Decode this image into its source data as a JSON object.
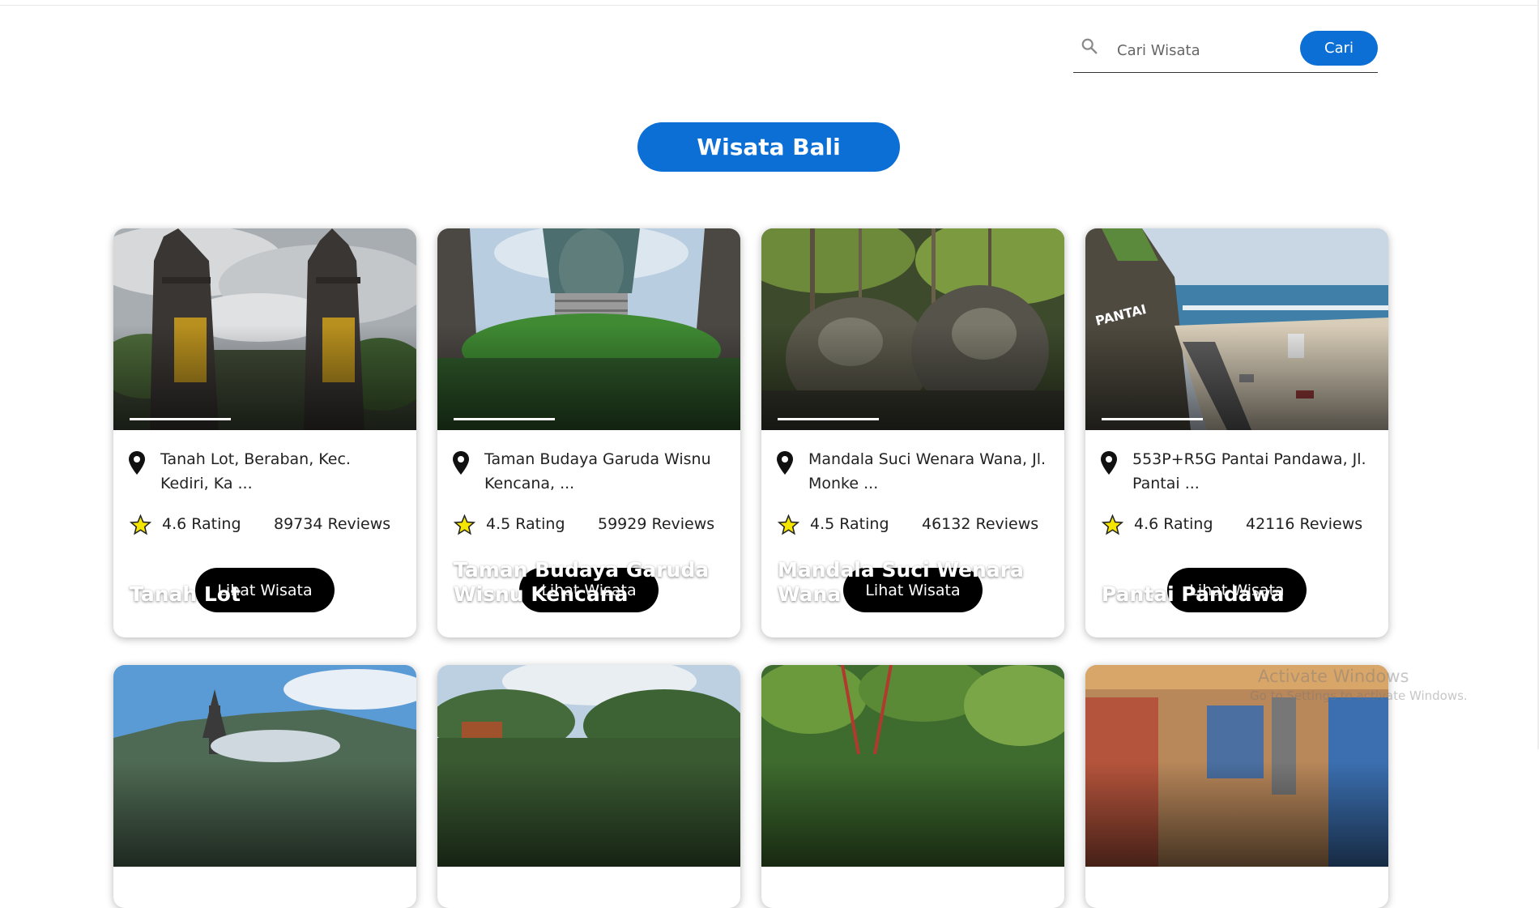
{
  "search": {
    "placeholder": "Cari Wisata",
    "value": "",
    "button_label": "Cari"
  },
  "page": {
    "title": "Wisata Bali"
  },
  "colors": {
    "accent": "#0b6fd6",
    "button_dark": "#000000",
    "star": "#f5e600"
  },
  "cards": [
    {
      "title": "Tanah Lot",
      "address": "Tanah Lot, Beraban, Kec. Kediri, Ka ...",
      "rating": "4.6 Rating",
      "reviews": "89734 Reviews",
      "button_label": "Lihat Wisata"
    },
    {
      "title": "Taman Budaya Garuda Wisnu Kencana",
      "address": "Taman Budaya Garuda Wisnu Kencana, ...",
      "rating": "4.5 Rating",
      "reviews": "59929 Reviews",
      "button_label": "Lihat Wisata"
    },
    {
      "title": "Mandala Suci Wenara Wana",
      "address": "Mandala Suci Wenara Wana, Jl. Monke ...",
      "rating": "4.5 Rating",
      "reviews": "46132 Reviews",
      "button_label": "Lihat Wisata"
    },
    {
      "title": "Pantai Pandawa",
      "address": "553P+R5G Pantai Pandawa, Jl. Pantai ...",
      "rating": "4.6 Rating",
      "reviews": "42116 Reviews",
      "button_label": "Lihat Wisata"
    }
  ],
  "watermark": {
    "line1": "Activate Windows",
    "line2": "Go to Settings to activate Windows."
  }
}
